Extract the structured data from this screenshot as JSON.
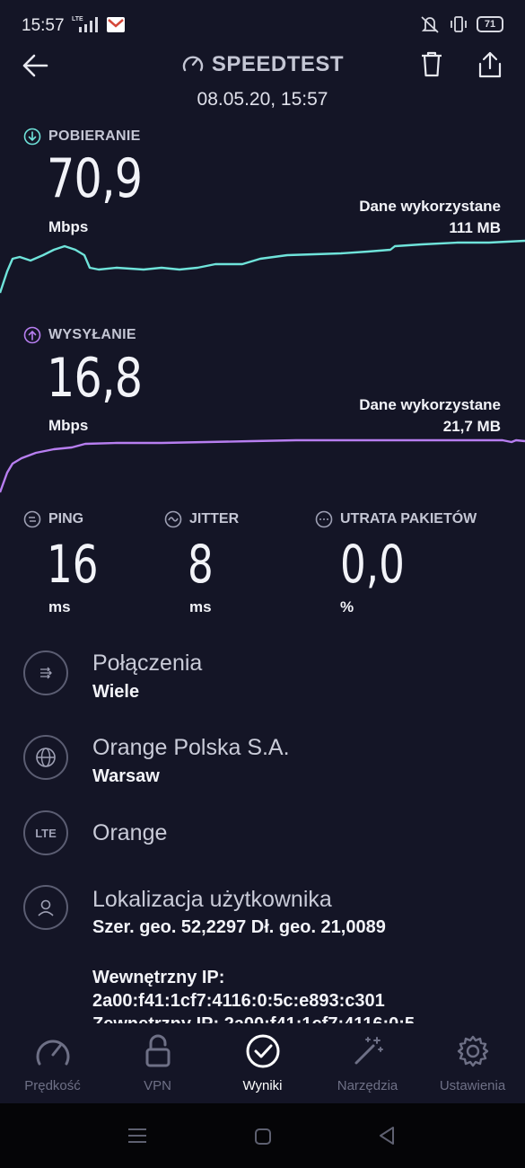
{
  "status_bar": {
    "time": "15:57",
    "network": "LTE",
    "battery": "71"
  },
  "header": {
    "title": "SPEEDTEST",
    "datetime": "08.05.20, 15:57"
  },
  "download": {
    "label": "POBIERANIE",
    "value": "70,9",
    "unit": "Mbps",
    "data_used_label": "Dane wykorzystane",
    "data_used_value": "111 MB",
    "color": "#6fe3da"
  },
  "upload": {
    "label": "WYSYŁANIE",
    "value": "16,8",
    "unit": "Mbps",
    "data_used_label": "Dane wykorzystane",
    "data_used_value": "21,7 MB",
    "color": "#b77ef0"
  },
  "metrics": {
    "ping": {
      "label": "PING",
      "value": "16",
      "unit": "ms"
    },
    "jitter": {
      "label": "JITTER",
      "value": "8",
      "unit": "ms"
    },
    "loss": {
      "label": "UTRATA PAKIETÓW",
      "value": "0,0",
      "unit": "%"
    }
  },
  "info": {
    "connections": {
      "title": "Połączenia",
      "value": "Wiele",
      "icon": "connections-icon"
    },
    "provider": {
      "title": "Orange Polska S.A.",
      "value": "Warsaw",
      "icon": "globe-icon"
    },
    "network": {
      "badge": "LTE",
      "title": "Orange",
      "icon": "lte-icon"
    },
    "location": {
      "title": "Lokalizacja użytkownika",
      "value": "Szer. geo. 52,2297 Dł. geo. 21,0089",
      "icon": "user-icon"
    },
    "internal_ip_label": "Wewnętrzny IP:",
    "internal_ip": "2a00:f41:1cf7:4116:0:5c:e893:c301",
    "external_ip_partial": "Zewnętrzny IP: 2a00:f41:1cf7:4116:0:5..."
  },
  "nav": {
    "items": [
      {
        "label": "Prędkość",
        "icon": "speedometer-icon",
        "active": false
      },
      {
        "label": "VPN",
        "icon": "lock-icon",
        "active": false
      },
      {
        "label": "Wyniki",
        "icon": "check-circle-icon",
        "active": true
      },
      {
        "label": "Narzędzia",
        "icon": "magic-wand-icon",
        "active": false
      },
      {
        "label": "Ustawienia",
        "icon": "gear-icon",
        "active": false
      }
    ]
  }
}
